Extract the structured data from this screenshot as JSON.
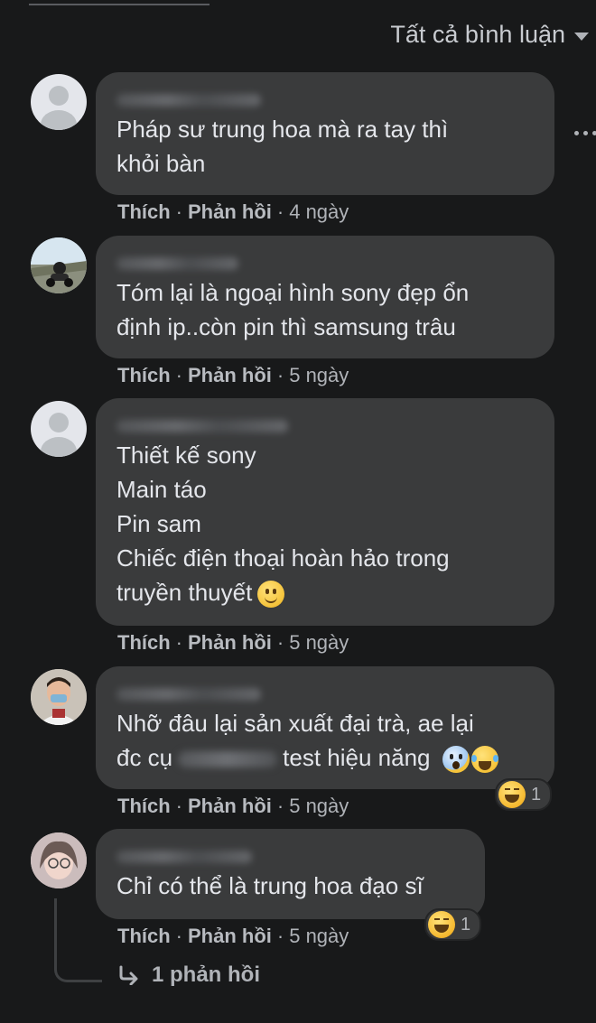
{
  "header": {
    "filter_label": "Tất cả bình luận"
  },
  "actions": {
    "like": "Thích",
    "reply": "Phản hồi"
  },
  "comments": [
    {
      "text": "Pháp sư trung hoa mà ra tay thì\nkhỏi bàn",
      "time": "4 ngày"
    },
    {
      "text": "Tóm lại là ngoại hình sony đẹp ổn\nđịnh ip..còn pin thì samsung trâu",
      "time": "5 ngày"
    },
    {
      "text": "Thiết kế sony\nMain táo\nPin sam\nChiếc điện thoại hoàn hảo trong\ntruyền thuyết",
      "time": "5 ngày"
    },
    {
      "text_line1": "Nhỡ đâu lại sản xuất đại trà, ae lại",
      "text_line2a": "đc cụ",
      "text_line2b": "test hiệu năng",
      "time": "5 ngày",
      "reaction_count": "1"
    },
    {
      "text": "Chỉ có thể là trung hoa đạo sĩ",
      "time": "5 ngày",
      "reaction_count": "1"
    }
  ],
  "replies_link": "1 phản hồi",
  "icons": {
    "more": "more-horizontal-icon",
    "reply_arrow": "reply-arrow-icon",
    "caret": "caret-down-icon"
  },
  "colors": {
    "background": "#18191a",
    "bubble": "#3a3b3c",
    "text": "#e4e6eb",
    "secondary": "#b0b3b8"
  }
}
